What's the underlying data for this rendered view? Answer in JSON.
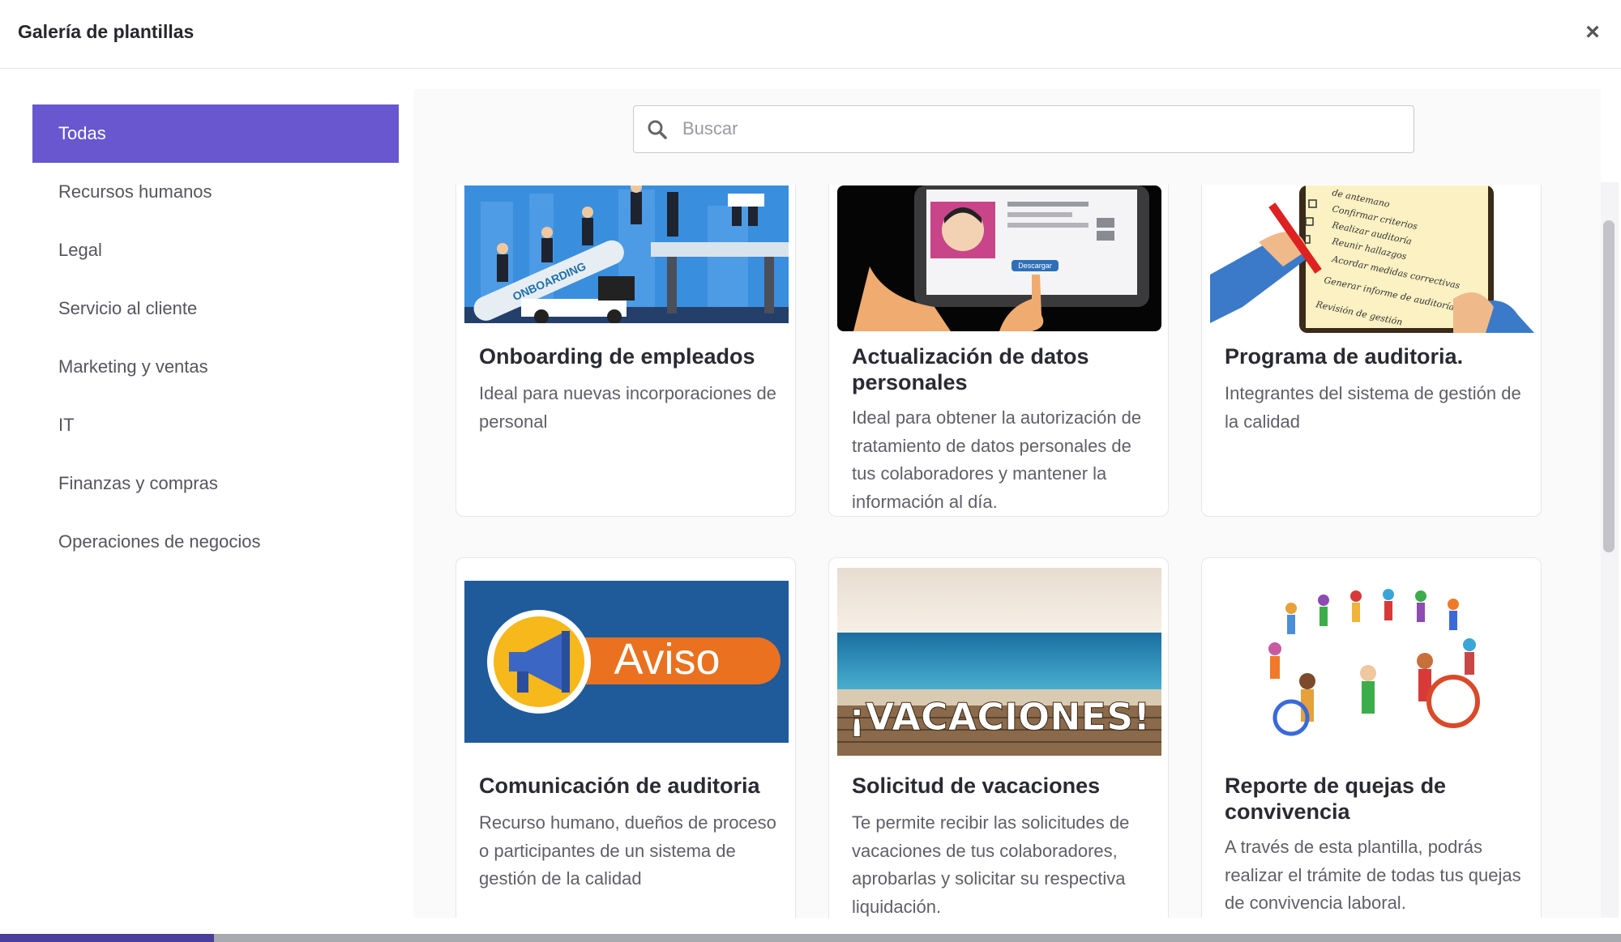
{
  "modal": {
    "title": "Galería de plantillas",
    "close_glyph": "×"
  },
  "sidebar": {
    "items": [
      {
        "label": "Todas",
        "active": true
      },
      {
        "label": "Recursos humanos"
      },
      {
        "label": "Legal"
      },
      {
        "label": "Servicio al cliente"
      },
      {
        "label": "Marketing y ventas"
      },
      {
        "label": "IT"
      },
      {
        "label": "Finanzas y compras"
      },
      {
        "label": "Operaciones de negocios"
      }
    ]
  },
  "search": {
    "placeholder": "Buscar",
    "value": ""
  },
  "cards": [
    {
      "title": "Onboarding de empleados",
      "description": "Ideal para nuevas incorporaciones de personal",
      "image_text": "ONBOARDING"
    },
    {
      "title": "Actualización de datos personales",
      "description": "Ideal para obtener la autorización de tratamiento de datos personales de tus colaboradores y mantener la información al día.",
      "image_text": "Descargar"
    },
    {
      "title": "Programa de auditoria.",
      "description": "Integrantes del sistema de gestión de la calidad",
      "image_lines": [
        "de antemano",
        "Confirmar criterios",
        "Realizar auditoría",
        "Reunir hallazgos",
        "Acordar medidas correctivas",
        "Generar informe de auditoría",
        "Revisión de gestión"
      ]
    },
    {
      "title": "Comunicación de auditoria",
      "description": "Recurso humano, dueños de proceso o participantes de un sistema de gestión de la calidad",
      "image_text": "Aviso"
    },
    {
      "title": "Solicitud de vacaciones",
      "description": "Te permite recibir las solicitudes de vacaciones de tus colaboradores, aprobarlas y solicitar su respectiva liquidación.",
      "image_text": "¡VACACIONES!"
    },
    {
      "title": "Reporte de quejas de convivencia",
      "description": "A través de esta plantilla, podrás realizar el trámite de todas tus quejas de convivencia laboral."
    }
  ],
  "colors": {
    "accent": "#6857cf",
    "text": "#2a2a33",
    "muted": "#5f5f68"
  }
}
